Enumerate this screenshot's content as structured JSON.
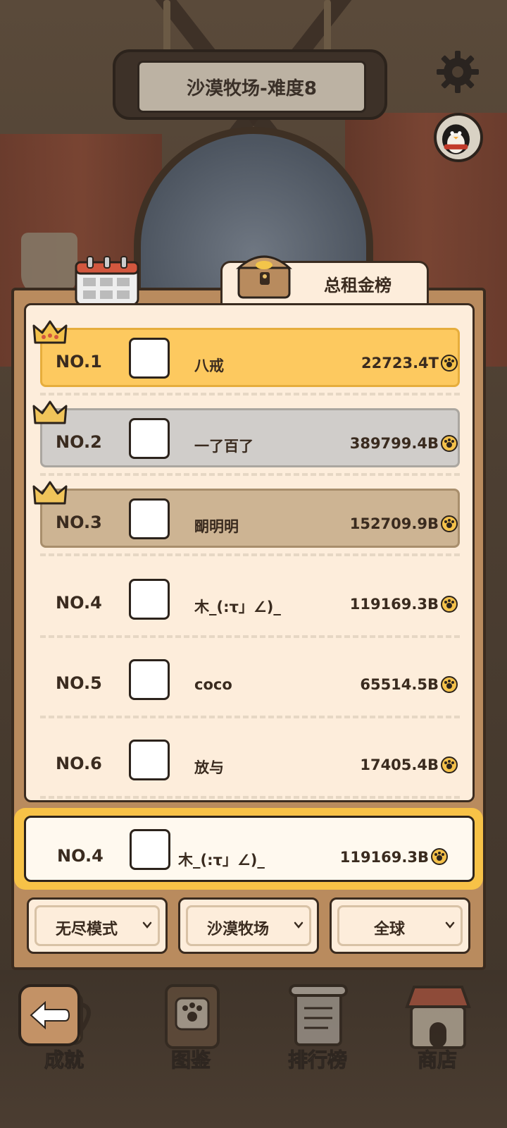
{
  "header": {
    "title": "沙漠牧场-难度8"
  },
  "leaderboard": {
    "tab_label": "总租金榜",
    "rows": [
      {
        "rank": "NO.1",
        "name": "八戒",
        "score": "22723.4T",
        "tier": "gold"
      },
      {
        "rank": "NO.2",
        "name": "一了百了",
        "score": "389799.4B",
        "tier": "silver"
      },
      {
        "rank": "NO.3",
        "name": "朙明明",
        "score": "152709.9B",
        "tier": "bronze"
      },
      {
        "rank": "NO.4",
        "name": "木_(:τ」∠)_",
        "score": "119169.3B",
        "tier": "none"
      },
      {
        "rank": "NO.5",
        "name": "coco",
        "score": "65514.5B",
        "tier": "none"
      },
      {
        "rank": "NO.6",
        "name": "放与",
        "score": "17405.4B",
        "tier": "none"
      }
    ],
    "self": {
      "rank": "NO.4",
      "name": "木_(:τ」∠)_",
      "score": "119169.3B"
    }
  },
  "filters": {
    "mode": "无尽模式",
    "map": "沙漠牧场",
    "region": "全球"
  },
  "bottom_nav": {
    "items": [
      {
        "label": "成就",
        "icon": "mug-icon"
      },
      {
        "label": "图鉴",
        "icon": "paw-book-icon"
      },
      {
        "label": "排行榜",
        "icon": "scroll-icon"
      },
      {
        "label": "商店",
        "icon": "shop-icon"
      }
    ]
  },
  "colors": {
    "gold_row": "#fdc95f",
    "silver_row": "#d0cdca",
    "bronze_row": "#cdb493",
    "highlight": "#f7c247",
    "panel": "#b98b5e"
  }
}
